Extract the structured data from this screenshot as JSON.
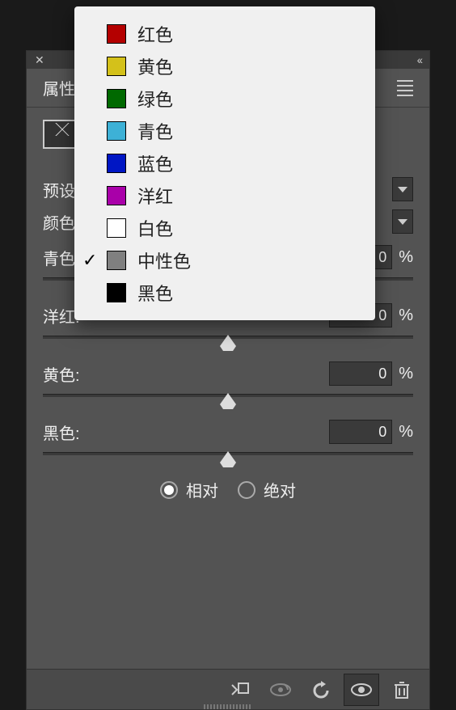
{
  "panel": {
    "title": "属性",
    "preset_label": "预设",
    "colors_label": "颜色"
  },
  "sliders": {
    "cyan": {
      "label": "青色:",
      "value": "0"
    },
    "magenta": {
      "label": "洋红:",
      "value": "0"
    },
    "yellow": {
      "label": "黄色:",
      "value": "0"
    },
    "black": {
      "label": "黑色:",
      "value": "0"
    }
  },
  "mode": {
    "relative": "相对",
    "absolute": "绝对",
    "selected": "relative"
  },
  "dropdown": {
    "selected_index": 7,
    "items": [
      {
        "label": "红色",
        "color": "#b40000"
      },
      {
        "label": "黄色",
        "color": "#d4c11a"
      },
      {
        "label": "绿色",
        "color": "#006900"
      },
      {
        "label": "青色",
        "color": "#3db1d6"
      },
      {
        "label": "蓝色",
        "color": "#0016c4"
      },
      {
        "label": "洋红",
        "color": "#a900a9"
      },
      {
        "label": "白色",
        "color": "#ffffff"
      },
      {
        "label": "中性色",
        "color": "#808080"
      },
      {
        "label": "黑色",
        "color": "#000000"
      }
    ]
  },
  "percent": "%"
}
